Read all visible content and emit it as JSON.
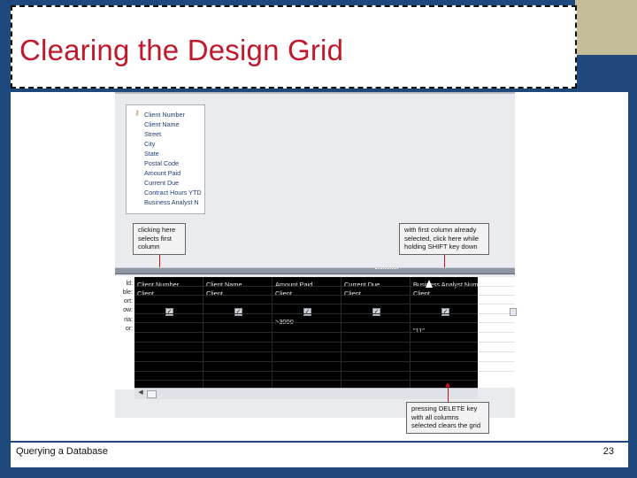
{
  "slide": {
    "title": "Clearing the Design Grid",
    "footer_left": "Querying a Database",
    "page_number": "23"
  },
  "field_list": {
    "items": [
      "Client Number",
      "Client Name",
      "Street",
      "City",
      "State",
      "Postal Code",
      "Amount Paid",
      "Current Due",
      "Contract Hours YTD",
      "Business Analyst N"
    ]
  },
  "row_headers": [
    "ld:",
    "ble:",
    "ort:",
    "ow:",
    "ria:",
    "or:"
  ],
  "design_grid": {
    "columns": [
      {
        "field": "Client Number",
        "table": "Client",
        "show": true,
        "criteria": "",
        "or": ""
      },
      {
        "field": "Client Name",
        "table": "Client",
        "show": true,
        "criteria": "",
        "or": ""
      },
      {
        "field": "Amount Paid",
        "table": "Client",
        "show": true,
        "criteria": ">3000",
        "or": ""
      },
      {
        "field": "Current Due",
        "table": "Client",
        "show": true,
        "criteria": "",
        "or": ""
      },
      {
        "field": "Business Analyst Num",
        "table": "Client",
        "show": true,
        "criteria": "",
        "or": "\"11\""
      }
    ],
    "checkmark_symbol": "✓"
  },
  "callouts": {
    "first_column": "clicking here selects first column",
    "shift_click": "with first column already selected, click here while holding SHIFT key down",
    "delete_key": "pressing DELETE key with all columns selected clears the grid"
  },
  "icons": {
    "key": "key-icon",
    "scroll_left": "scroll-left-arrow-icon",
    "pointer": "mouse-pointer-icon"
  },
  "colors": {
    "title_red": "#c0192b",
    "navy": "#1f497d",
    "tan": "#c4bd97",
    "arrow_red": "#d10f1f"
  }
}
